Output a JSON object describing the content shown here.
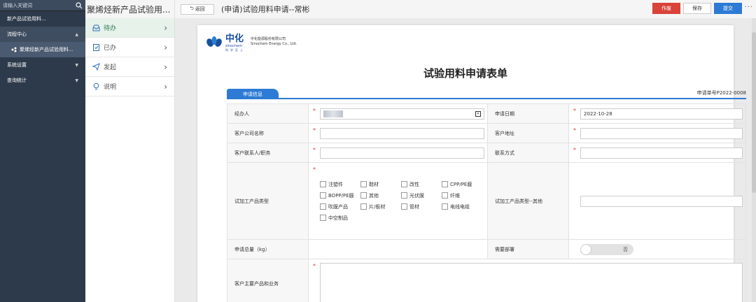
{
  "sidebar": {
    "search_placeholder": "请输入关键词",
    "items": [
      {
        "label": "新产品试验用料..."
      },
      {
        "label": "流程中心"
      },
      {
        "label": "聚烯烃新产品试验用料..."
      },
      {
        "label": "系统设置"
      },
      {
        "label": "查询统计"
      }
    ]
  },
  "list": {
    "title": "聚烯烃新产品试验用...",
    "items": [
      {
        "label": "待办"
      },
      {
        "label": "已办"
      },
      {
        "label": "发起"
      },
      {
        "label": "说明"
      }
    ]
  },
  "topbar": {
    "back_label": "返回",
    "doc_title": "(申请)试验用料申请--常彬",
    "void_label": "作废",
    "save_label": "保存",
    "submit_label": "提交",
    "more_label": "···"
  },
  "colors": {
    "accent": "#2d7bd4",
    "danger": "#d9433a",
    "sidebar": "#2d3a4b",
    "active_green": "#2e7d4f"
  },
  "logo": {
    "cn": "中化",
    "en": "sinochem",
    "company_cn": "中化能源股份有限公司",
    "company_en": "Sinochem Energy Co., Ltd.",
    "slogan": "科学至上"
  },
  "form": {
    "title": "试验用料申请表单",
    "tab_label": "申请信息",
    "order_no": "申请单号P2022-0008",
    "fields": {
      "handler_label": "经办人",
      "apply_date_label": "申请日期",
      "apply_date_value": "2022-10-28",
      "customer_company_label": "客户公司名称",
      "customer_address_label": "客户地址",
      "customer_contact_label": "客户联系人/职务",
      "contact_method_label": "联系方式",
      "product_type_label": "试加工产品类型",
      "product_type_other_label": "试加工产品类型--其他",
      "total_qty_label": "申请总量（kg）",
      "need_dept_label": "需要部署",
      "need_dept_value": "否",
      "main_products_label": "客户主要产品和业务"
    },
    "product_types": [
      "注塑件",
      "鞋材",
      "改性",
      "CPP/PE膜",
      "BOPP/PE膜",
      "其他",
      "光伏膜",
      "纤维",
      "吹膜产品",
      "片/板材",
      "管材",
      "电线电缆",
      "中空制品"
    ]
  }
}
